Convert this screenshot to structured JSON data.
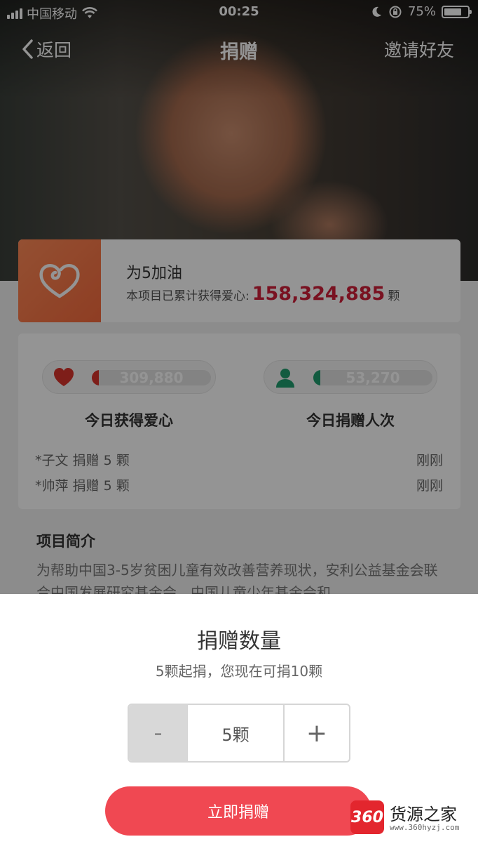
{
  "status_bar": {
    "carrier": "中国移动",
    "time": "00:25",
    "battery": "75%",
    "battery_level": 0.75
  },
  "nav": {
    "back_label": "返回",
    "title": "捐赠",
    "invite_label": "邀请好友"
  },
  "project": {
    "name": "为5加油",
    "total_prefix": "本项目已累计获得爱心:",
    "total_value": "158,324,885",
    "total_unit": "颗"
  },
  "stats": {
    "hearts_today": "309,880",
    "hearts_label": "今日获得爱心",
    "donors_today": "53,270",
    "donors_label": "今日捐赠人次",
    "colors": {
      "heart": "#d9342b",
      "donor": "#1f9d6e"
    }
  },
  "donations": [
    {
      "donor": "*子文 捐赠 5 颗",
      "time": "刚刚"
    },
    {
      "donor": "*帅萍 捐赠 5 颗",
      "time": "刚刚"
    }
  ],
  "intro": {
    "title": "项目简介",
    "text": "为帮助中国3-5岁贫困儿童有效改善营养现状，安利公益基金会联合中国发展研究基金会、中国儿童少年基金会和"
  },
  "sheet": {
    "title": "捐赠数量",
    "subtitle": "5颗起捐，您现在可捐10颗",
    "minus_label": "-",
    "quantity": "5颗",
    "plus_label": "+",
    "donate_label": "立即捐赠",
    "accent": "#f04852"
  },
  "watermark": {
    "badge": "360",
    "name": "货源之家",
    "url": "www.360hyzj.com"
  }
}
